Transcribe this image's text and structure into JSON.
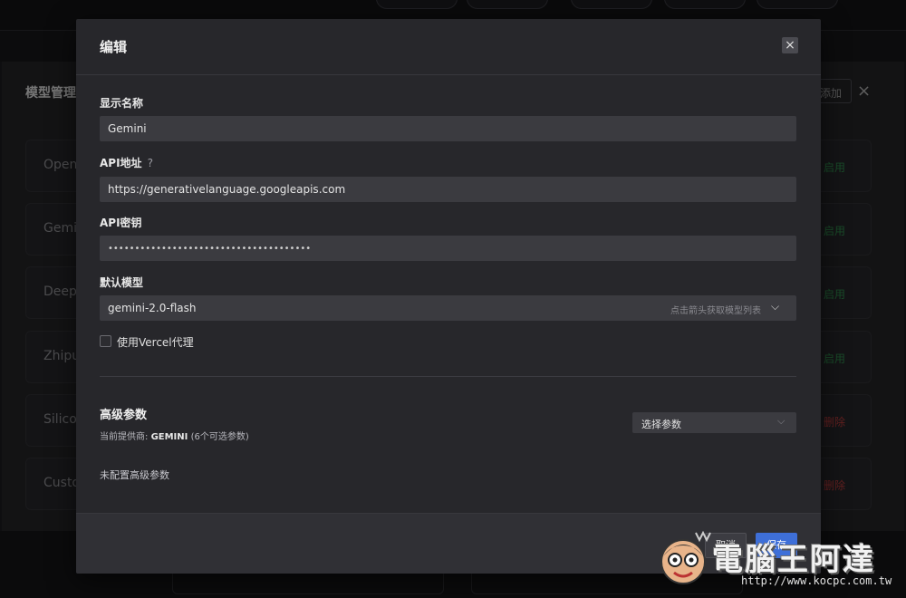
{
  "background": {
    "title": "模型管理",
    "add_label": "添加",
    "close_glyph": "×",
    "providers": [
      {
        "name": "OpenAI",
        "status": "启用",
        "status_color": "#2f8a4b"
      },
      {
        "name": "Gemini",
        "status": "启用",
        "status_color": "#2f8a4b"
      },
      {
        "name": "DeepSeek",
        "status": "启用",
        "status_color": "#2f8a4b"
      },
      {
        "name": "Zhipu",
        "status": "启用",
        "status_color": "#2f8a4b"
      },
      {
        "name": "SiliconFlow",
        "status": "删除",
        "status_color": "#b23a3a"
      },
      {
        "name": "Custom",
        "status": "删除",
        "status_color": "#b23a3a"
      }
    ]
  },
  "modal": {
    "title": "编辑",
    "close_glyph": "×",
    "display_name": {
      "label": "显示名称",
      "value": "Gemini"
    },
    "api_url": {
      "label": "API地址",
      "help": "?",
      "value": "https://generativelanguage.googleapis.com"
    },
    "api_key": {
      "label": "API密钥",
      "value": "••••••••••••••••••••••••••••••••••••••"
    },
    "default_model": {
      "label": "默认模型",
      "value": "gemini-2.0-flash",
      "hint": "点击箭头获取模型列表",
      "chevron": "⌵"
    },
    "vercel_proxy": {
      "label": "使用Vercel代理",
      "checked": false
    },
    "advanced": {
      "title": "高级参数",
      "provider_prefix": "当前提供商:",
      "provider_name": "GEMINI",
      "provider_suffix": "(6个可选参数)",
      "select_placeholder": "选择参数",
      "chevron": "⌵",
      "empty_text": "未配置高级参数"
    },
    "footer": {
      "cancel_label": "取消",
      "save_label": "保存"
    }
  },
  "watermark": {
    "brand": "電腦王阿達",
    "url": "http://www.kocpc.com.tw"
  },
  "colors": {
    "accent": "#3e6fd8",
    "modal_bg": "#27272b",
    "field_bg": "#3b3b40"
  }
}
